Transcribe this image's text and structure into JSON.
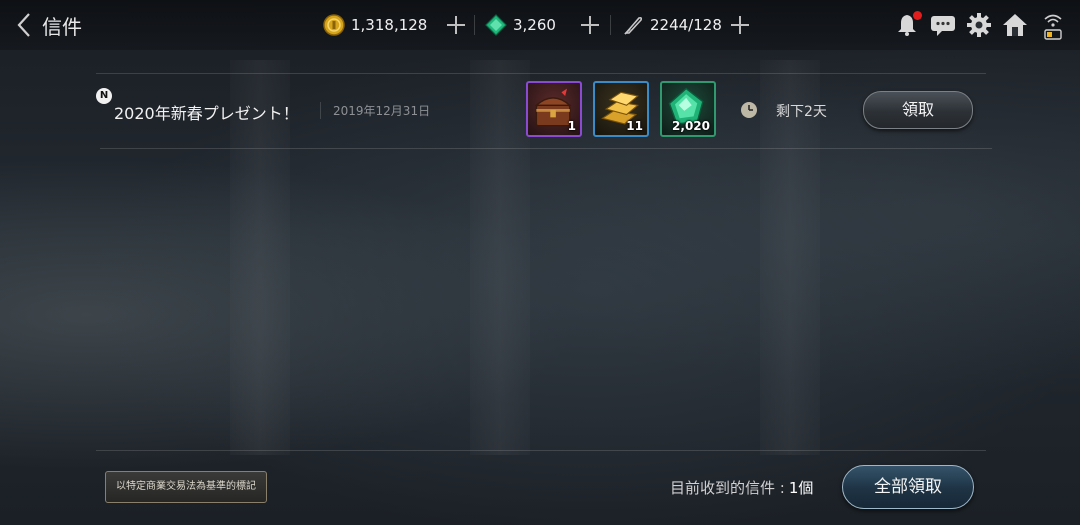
{
  "header": {
    "title": "信件",
    "resources": [
      {
        "name": "gold",
        "value": "1,318,128",
        "icon": "gold-coin-icon",
        "color": "#d6a51c"
      },
      {
        "name": "gems",
        "value": "3,260",
        "icon": "emerald-gem-icon",
        "color": "#1fb77b"
      },
      {
        "name": "stamina",
        "value": "2244/128",
        "icon": "quill-icon",
        "color": "#bbbbbb"
      }
    ],
    "icons": [
      "bell-icon",
      "chat-icon",
      "gear-icon",
      "home-icon",
      "wifi-battery-icon"
    ],
    "notification_dot_color": "#e21d1d"
  },
  "mails": [
    {
      "new_badge": "N",
      "title": "2020年新春プレゼント！",
      "date": "2019年12月31日",
      "items": [
        {
          "icon": "treasure-chest-icon",
          "qty": "1",
          "border": "#8a4bd2"
        },
        {
          "icon": "gold-bars-icon",
          "qty": "11",
          "border": "#3a8cc8"
        },
        {
          "icon": "emerald-gem-icon",
          "qty": "2,020",
          "border": "#2f9a70"
        }
      ],
      "remaining": "剩下2天",
      "claim_label": "領取"
    }
  ],
  "footer": {
    "legal_label": "以特定商業交易法為基準的標記",
    "count_label": "目前收到的信件 :",
    "count_value": "1個",
    "claim_all_label": "全部領取"
  }
}
